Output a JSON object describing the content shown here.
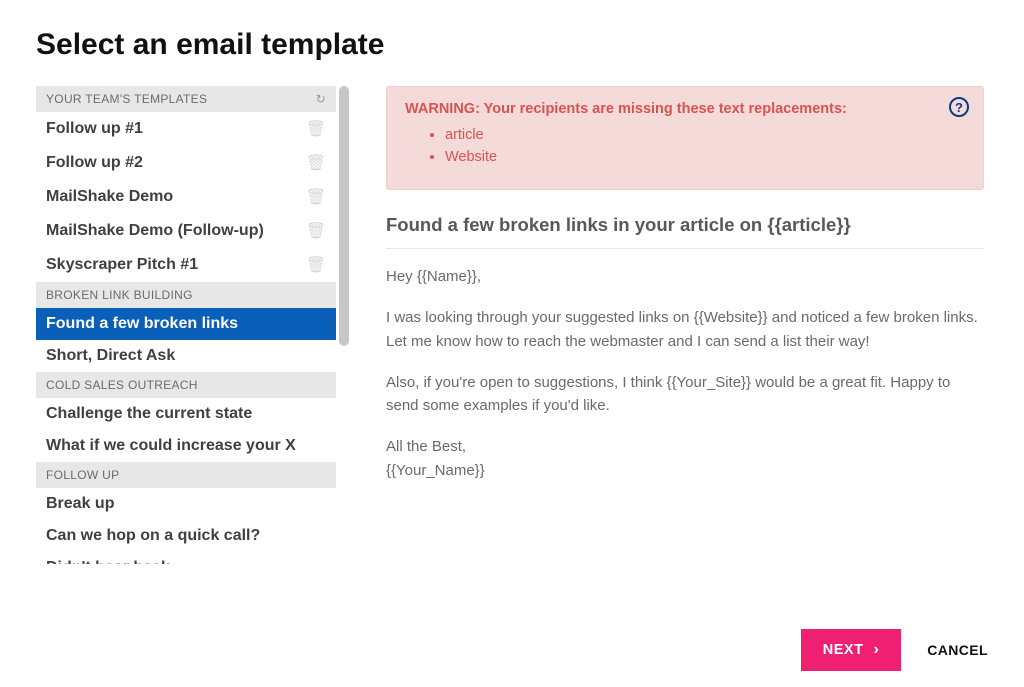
{
  "title": "Select an email template",
  "sidebar": {
    "groups": [
      {
        "label": "YOUR TEAM'S TEMPLATES",
        "refresh": true,
        "items": [
          {
            "label": "Follow up #1",
            "deletable": true
          },
          {
            "label": "Follow up #2",
            "deletable": true
          },
          {
            "label": "MailShake Demo",
            "deletable": true
          },
          {
            "label": "MailShake Demo (Follow-up)",
            "deletable": true
          },
          {
            "label": "Skyscraper Pitch #1",
            "deletable": true
          }
        ]
      },
      {
        "label": "BROKEN LINK BUILDING",
        "items": [
          {
            "label": "Found a few broken links",
            "selected": true
          },
          {
            "label": "Short, Direct Ask"
          }
        ]
      },
      {
        "label": "COLD SALES OUTREACH",
        "items": [
          {
            "label": "Challenge the current state"
          },
          {
            "label": "What if we could increase your X"
          }
        ]
      },
      {
        "label": "FOLLOW UP",
        "items": [
          {
            "label": "Break up"
          },
          {
            "label": "Can we hop on a quick call?"
          },
          {
            "label": "Didn't hear back"
          }
        ]
      }
    ]
  },
  "preview": {
    "warning_title": "WARNING: Your recipients are missing these text replacements:",
    "warning_items": [
      "article",
      "Website"
    ],
    "subject": "Found a few broken links in your article on {{article}}",
    "paragraphs": [
      "Hey {{Name}},",
      "I was looking through your suggested links on {{Website}} and noticed a few broken links. Let me know how to reach the webmaster and I can send a list their way!",
      "Also, if you're open to suggestions, I think {{Your_Site}} would be a great fit. Happy to send some examples if you'd like.",
      "All the Best,\n{{Your_Name}}"
    ]
  },
  "footer": {
    "next": "NEXT",
    "cancel": "CANCEL"
  }
}
